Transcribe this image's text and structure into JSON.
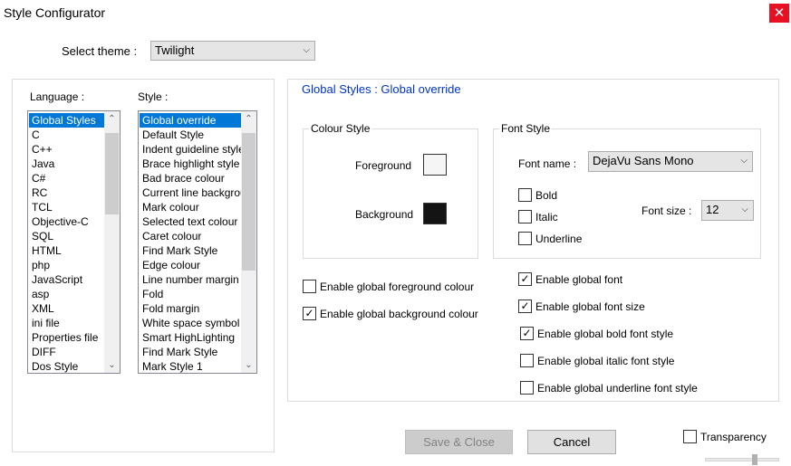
{
  "window": {
    "title": "Style Configurator",
    "close_icon": "✕"
  },
  "theme": {
    "label": "Select theme :",
    "value": "Twilight"
  },
  "language": {
    "label": "Language :",
    "items": [
      "Global Styles",
      "C",
      "C++",
      "Java",
      "C#",
      "RC",
      "TCL",
      "Objective-C",
      "SQL",
      "HTML",
      "php",
      "JavaScript",
      "asp",
      "XML",
      "ini file",
      "Properties file",
      "DIFF",
      "Dos Style"
    ],
    "selected_index": 0
  },
  "style": {
    "label": "Style :",
    "items": [
      "Global override",
      "Default Style",
      "Indent guideline style",
      "Brace highlight style",
      "Bad brace colour",
      "Current line background colour",
      "Mark colour",
      "Selected text colour",
      "Caret colour",
      "Find Mark Style",
      "Edge colour",
      "Line number margin",
      "Fold",
      "Fold margin",
      "White space symbol",
      "Smart HighLighting",
      "Find Mark Style",
      "Mark Style 1"
    ],
    "selected_index": 0
  },
  "panel": {
    "title": "Global Styles : Global override"
  },
  "colour_style": {
    "title": "Colour Style",
    "foreground_label": "Foreground",
    "background_label": "Background",
    "foreground_color": "#f5f5f5",
    "background_color": "#141414"
  },
  "font_style": {
    "title": "Font Style",
    "font_name_label": "Font name :",
    "font_name_value": "DejaVu Sans Mono",
    "bold_label": "Bold",
    "italic_label": "Italic",
    "underline_label": "Underline",
    "font_size_label": "Font size :",
    "font_size_value": "12"
  },
  "options": {
    "global_fg": {
      "label": "Enable global foreground colour",
      "checked": false
    },
    "global_bg": {
      "label": "Enable global background colour",
      "checked": true
    },
    "global_font": {
      "label": "Enable global font",
      "checked": true
    },
    "global_font_size": {
      "label": "Enable global font size",
      "checked": true
    },
    "global_bold": {
      "label": "Enable global bold font style",
      "checked": true
    },
    "global_italic": {
      "label": "Enable global italic font style",
      "checked": false
    },
    "global_underline": {
      "label": "Enable global underline font style",
      "checked": false
    }
  },
  "buttons": {
    "save_close": "Save & Close",
    "cancel": "Cancel"
  },
  "transparency": {
    "label": "Transparency",
    "checked": false
  },
  "icons": {
    "check": "✓",
    "dropdown": "⌵",
    "scroll_up": "⌃",
    "scroll_down": "⌄"
  }
}
